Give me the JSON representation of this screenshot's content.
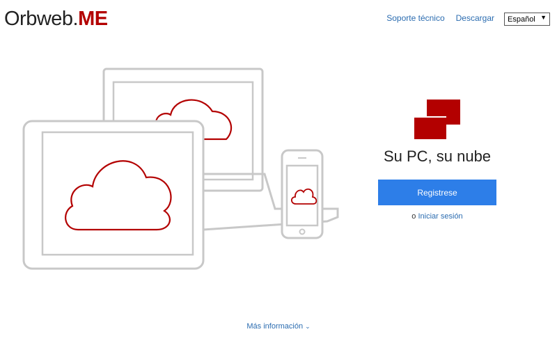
{
  "header": {
    "logo_main": "Orbweb",
    "logo_dot": ".",
    "logo_suffix": "ME",
    "nav": {
      "support": "Soporte técnico",
      "download": "Descargar"
    },
    "language": {
      "selected": "Español",
      "arrow": "▼"
    }
  },
  "hero": {
    "tagline": "Su PC, su nube",
    "register_label": "Registrese",
    "login_prefix": "o",
    "login_label": "Iniciar sesión"
  },
  "footer": {
    "more_info_label": "Más información",
    "more_info_icon": "chevron-down-icon"
  },
  "colors": {
    "brand_red": "#b30000",
    "accent_blue": "#2d7ee8",
    "link_blue": "#2b6cb0",
    "device_outline": "#c8c8c8"
  }
}
